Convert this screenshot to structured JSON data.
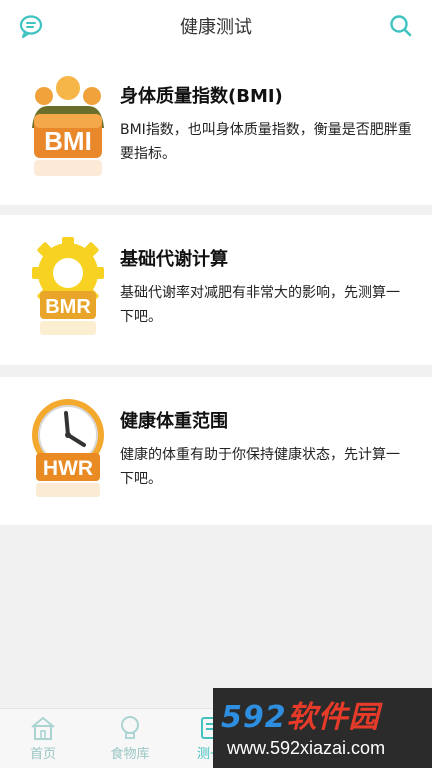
{
  "header": {
    "title": "健康测试",
    "left_icon": "chat-icon",
    "right_icon": "search-icon",
    "accent": "#3fc3c0"
  },
  "cards": [
    {
      "icon": "bmi-people-icon",
      "icon_text": "BMI",
      "title": "身体质量指数(BMI)",
      "desc": "BMI指数，也叫身体质量指数，衡量是否肥胖重要指标。"
    },
    {
      "icon": "bmr-gear-icon",
      "icon_text": "BMR",
      "title": "基础代谢计算",
      "desc": "基础代谢率对减肥有非常大的影响，先测算一下吧。"
    },
    {
      "icon": "hwr-clock-icon",
      "icon_text": "HWR",
      "title": "健康体重范围",
      "desc": "健康的体重有助于你保持健康状态，先计算一下吧。"
    }
  ],
  "tabs": [
    {
      "label": "首页",
      "icon": "home-icon"
    },
    {
      "label": "食物库",
      "icon": "bulb-icon"
    },
    {
      "label": "测一",
      "icon": "test-icon",
      "active": true
    }
  ],
  "watermark": {
    "line1_num": "592",
    "line1_text": "软件园",
    "line2": "www.592xiazai.com"
  }
}
